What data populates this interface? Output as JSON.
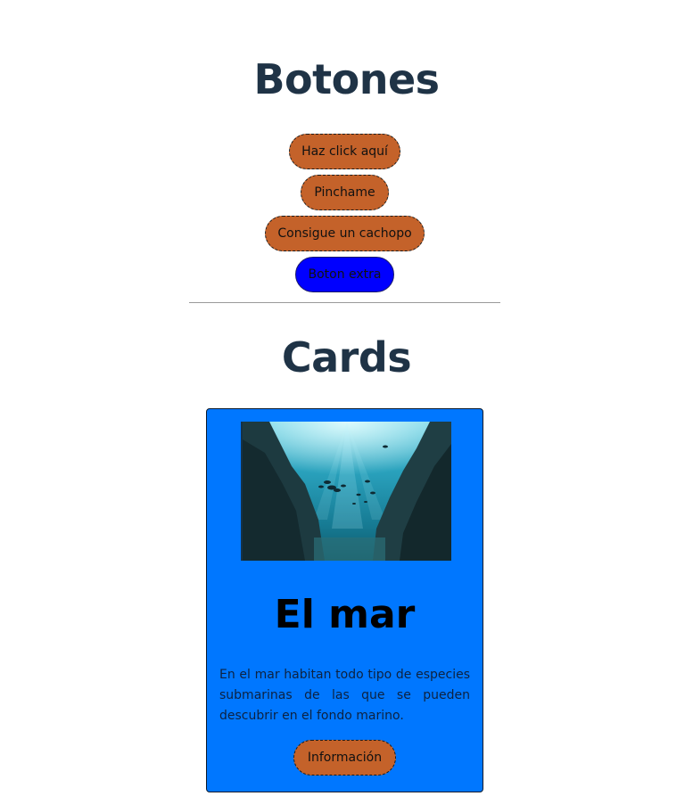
{
  "sections": {
    "buttons_title": "Botones",
    "cards_title": "Cards"
  },
  "buttons": [
    {
      "label": "Haz click aquí"
    },
    {
      "label": "Pinchame"
    },
    {
      "label": "Consigue un cachopo"
    },
    {
      "label": "Boton extra"
    }
  ],
  "card": {
    "image_alt": "underwater-sea-photo",
    "title": "El mar",
    "text": "En el mar habitan todo tipo de especies submarinas de las que se pueden descubrir en el fondo marino.",
    "button_label": "Información"
  },
  "colors": {
    "heading": "#1f3346",
    "button_orange": "#c4622a",
    "button_blue": "#0000ff",
    "card_background": "#0077ff"
  }
}
